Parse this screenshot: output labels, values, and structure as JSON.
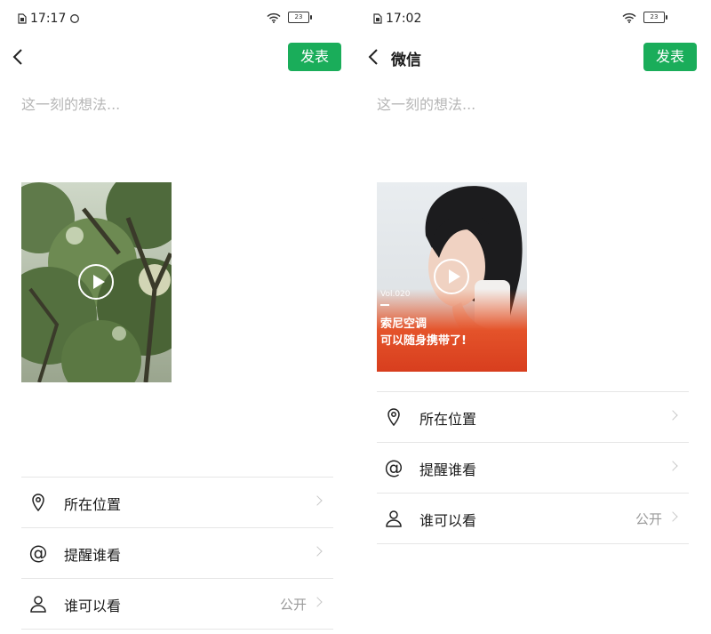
{
  "left": {
    "status": {
      "time": "17:17",
      "battery": "23"
    },
    "nav": {
      "post_label": "发表"
    },
    "thought_placeholder": "这一刻的想法...",
    "rows": [
      {
        "label": "所在位置",
        "value": ""
      },
      {
        "label": "提醒谁看",
        "value": ""
      },
      {
        "label": "谁可以看",
        "value": "公开"
      }
    ]
  },
  "right": {
    "status": {
      "time": "17:02",
      "battery": "23"
    },
    "nav": {
      "title": "微信",
      "post_label": "发表"
    },
    "thought_placeholder": "这一刻的想法...",
    "video_overlay": {
      "vol": "Vol.020",
      "line1": "索尼空调",
      "line2": "可以随身携带了!"
    },
    "rows": [
      {
        "label": "所在位置",
        "value": ""
      },
      {
        "label": "提醒谁看",
        "value": ""
      },
      {
        "label": "谁可以看",
        "value": "公开"
      }
    ]
  },
  "colors": {
    "accent": "#1aad5a",
    "placeholder": "#b6b6b6",
    "divider": "#e6e6e6"
  }
}
